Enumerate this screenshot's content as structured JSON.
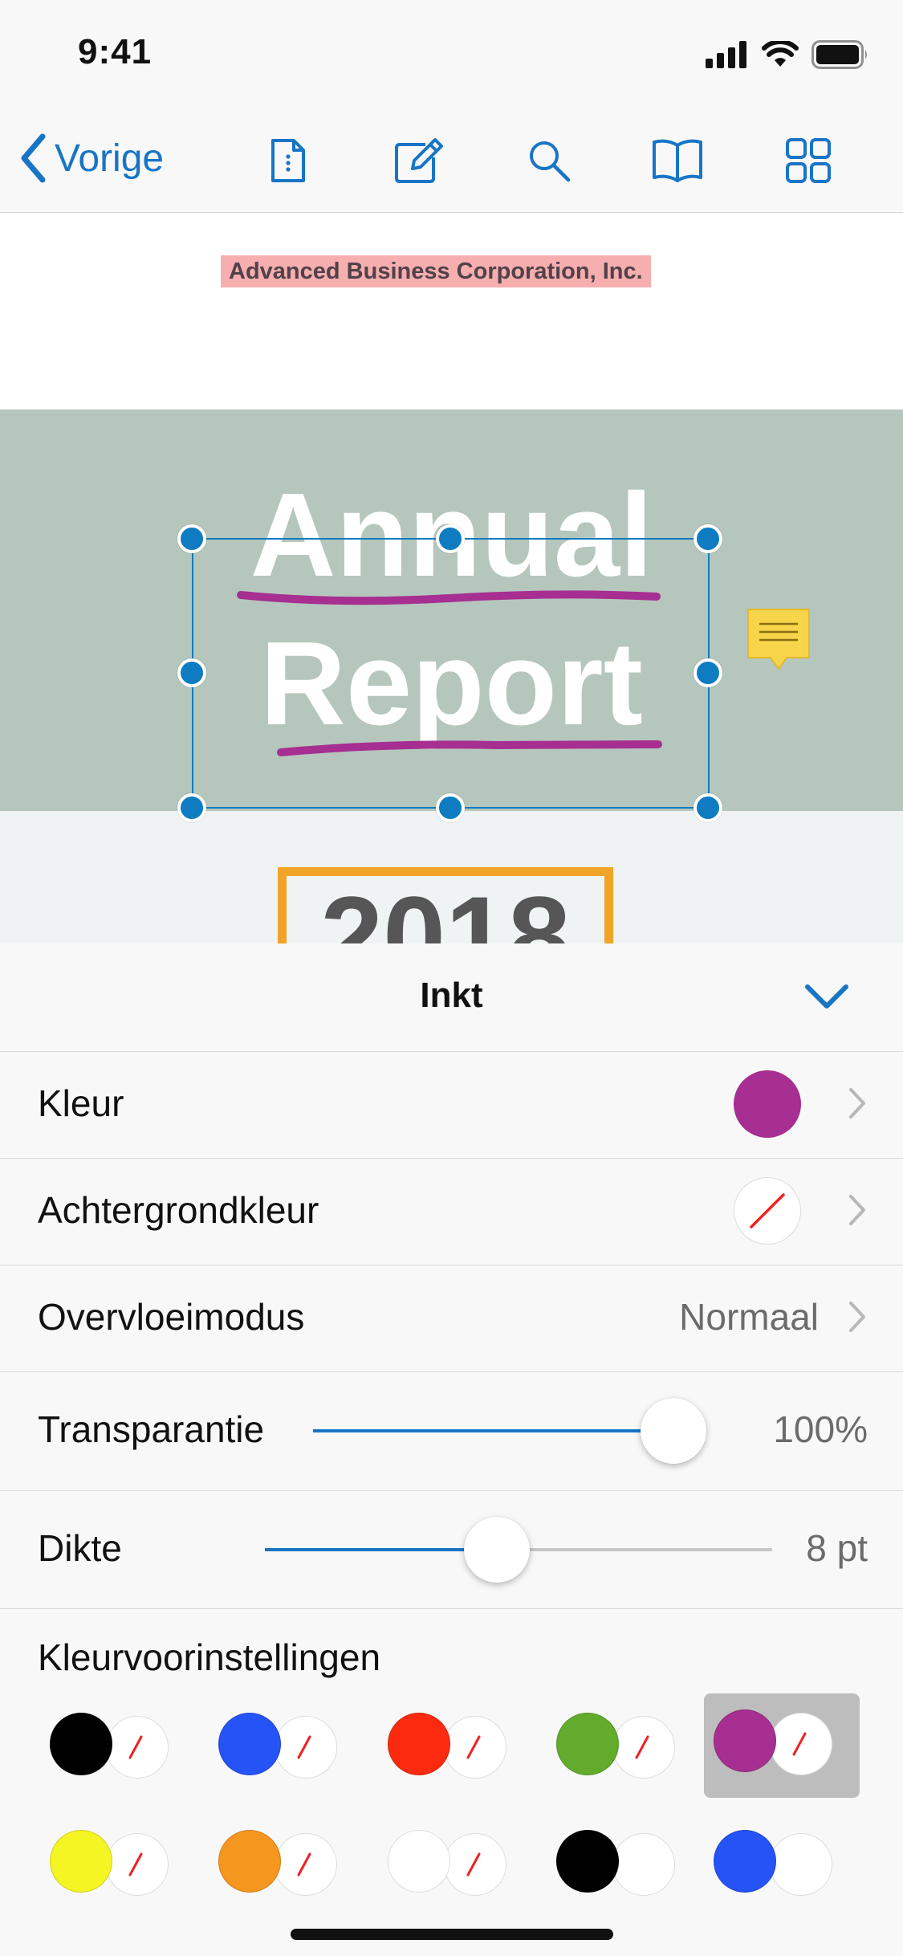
{
  "status": {
    "time": "9:41"
  },
  "toolbar": {
    "back_label": "Vorige"
  },
  "document": {
    "company": "Advanced Business Corporation, Inc.",
    "title_line1": "Annual",
    "title_line2": "Report",
    "year": "2018"
  },
  "panel": {
    "title": "Inkt",
    "color_label": "Kleur",
    "color_value": "#a62f91",
    "background_label": "Achtergrondkleur",
    "background_value": "none",
    "blend_label": "Overvloeimodus",
    "blend_value": "Normaal",
    "transparency_label": "Transparantie",
    "transparency_value": "100%",
    "transparency_fraction": 1.0,
    "thickness_label": "Dikte",
    "thickness_value": "8 pt",
    "thickness_fraction": 0.45,
    "presets_label": "Kleurvoorinstellingen"
  },
  "presets": [
    {
      "fg": "#000000",
      "bg": "none"
    },
    {
      "fg": "#2553f5",
      "bg": "none"
    },
    {
      "fg": "#fc2a0f",
      "bg": "none"
    },
    {
      "fg": "#62ab2d",
      "bg": "none"
    },
    {
      "fg": "#a62f91",
      "bg": "none",
      "selected": true
    },
    {
      "fg": "#f5f523",
      "bg": "none"
    },
    {
      "fg": "#f5961e",
      "bg": "none"
    },
    {
      "fg": "#ffffff",
      "bg": "none"
    },
    {
      "fg": "#000000",
      "bg": "#ffffff"
    },
    {
      "fg": "#2553f5",
      "bg": "#ffffff"
    }
  ],
  "colors": {
    "accent": "#1775c6",
    "ink": "#a62f91",
    "handle": "#0f7cc2"
  }
}
